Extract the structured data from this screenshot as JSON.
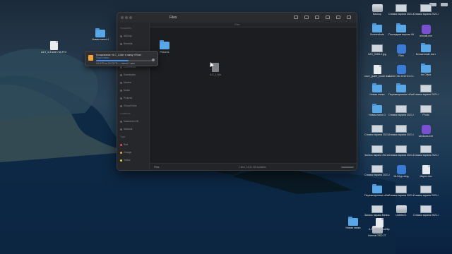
{
  "finder": {
    "title": "Files",
    "path_bar": "Files",
    "status": "1 item, 18,31 GB available",
    "bottom_path": "Files",
    "items": [
      {
        "label": "Pictures",
        "icon": "folder-icon"
      },
      {
        "label": "ILC_1.Ma",
        "icon": "document-icon",
        "selected": true
      }
    ],
    "sidebar": [
      {
        "label": "Favourites"
      },
      {
        "label": "AirDrop"
      },
      {
        "label": "Recents"
      },
      {
        "label": "Applications"
      },
      {
        "label": "Desktop"
      },
      {
        "label": "Documents"
      },
      {
        "label": "Downloads"
      },
      {
        "label": "Movies"
      },
      {
        "label": "Music"
      },
      {
        "label": "Pictures"
      },
      {
        "label": "iCloud Drive"
      },
      {
        "label": "Locations"
      },
      {
        "label": "Macintosh HD"
      },
      {
        "label": "Network"
      },
      {
        "label": "Tags"
      },
      {
        "label": "Red"
      },
      {
        "label": "Orange"
      },
      {
        "label": "Yellow"
      }
    ]
  },
  "copy_popup": {
    "title": "Копирование «ILC_1.Ma» в папку «Files»",
    "subtitle": "Подготовка...",
    "detail": "14,3 ГБ из 24,72 ГБ — около 1 мин",
    "progress_fraction": 0.58
  },
  "desktop_left": [
    {
      "label": "Новая папка 4",
      "type": "folder"
    },
    {
      "label": "dd.5_4.3 6287746.PDF",
      "type": "document"
    }
  ],
  "desktop_right": [
    {
      "label": "Backup",
      "type": "disk"
    },
    {
      "label": "Снимок экрана 2021-04-...20.png",
      "type": "image"
    },
    {
      "label": "Снимок экрана 2021-04-...20.png",
      "type": "image"
    },
    {
      "label": "Screenshots",
      "type": "folder"
    },
    {
      "label": "Последняя версия 9959.app",
      "type": "folder"
    },
    {
      "label": "miniutil.exe",
      "type": "app"
    },
    {
      "label": "IMG_0065-2.jpg",
      "type": "image"
    },
    {
      "label": "Files",
      "type": "app"
    },
    {
      "label": "Вложенный лист",
      "type": "folder"
    },
    {
      "label": "save_guide_tcode docs2.0.1.pdf",
      "type": "document"
    },
    {
      "label": "Adobe XD 2019 5.0.0.app",
      "type": "app"
    },
    {
      "label": "for Olivia",
      "type": "folder"
    },
    {
      "label": "Новая папка",
      "type": "folder"
    },
    {
      "label": "Перемещенные объекты",
      "type": "folder"
    },
    {
      "label": "Снимок экрана 2021-04-...29.png",
      "type": "image"
    },
    {
      "label": "Новая папка 3",
      "type": "folder"
    },
    {
      "label": "Снимок экрана 2021-04-...24.png",
      "type": "image"
    },
    {
      "label": "Photo",
      "type": "image"
    },
    {
      "label": "Снимок экрана 2021-04-...25.png",
      "type": "image"
    },
    {
      "label": "Снимок экрана 2021-04-...26.png",
      "type": "image"
    },
    {
      "label": "windows.exe",
      "type": "app"
    },
    {
      "label": "Запись экрана 2021-04-...15.mov",
      "type": "image"
    },
    {
      "label": "Снимок экрана 2021-04-...26.png",
      "type": "image"
    },
    {
      "label": "Снимок экрана 2021-04-...27.png",
      "type": "image"
    },
    {
      "label": "Снимок экрана 2021-04-...32.png",
      "type": "image"
    },
    {
      "label": "NL2App.dmg",
      "type": "app"
    },
    {
      "label": "Иврос.doc",
      "type": "document"
    },
    {
      "label": "Перемещенные объекты",
      "type": "folder"
    },
    {
      "label": "Снимок экрана 2021-04-...28.png",
      "type": "image"
    },
    {
      "label": "Снимок экрана 2021-04-...32.png",
      "type": "image"
    },
    {
      "label": "Запись экрана Венис...Должен",
      "type": "image"
    },
    {
      "label": "Untitled 1",
      "type": "disk"
    },
    {
      "label": "Снимок экрана 2021-04-...20.png",
      "type": "image"
    },
    {
      "label": "Internal SSD 2T",
      "type": "disk"
    }
  ],
  "desktop_bottom": [
    {
      "label": "Новая папка",
      "type": "folder"
    },
    {
      "label": "ILS_0002.bmd26p",
      "type": "document"
    }
  ],
  "colors": {
    "folder": "#5aa7e8",
    "accent": "#3d8ef0",
    "window_bg": "#1e1f22"
  }
}
